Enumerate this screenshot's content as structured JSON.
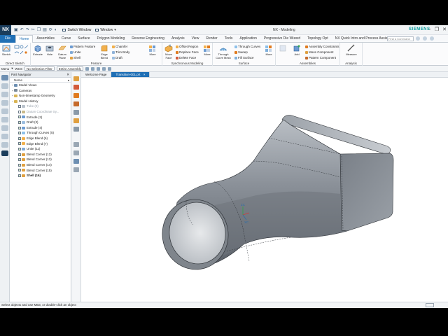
{
  "titlebar": {
    "logo": "NX",
    "switch_window": "Switch Window",
    "window_menu": "Window",
    "app_title": "NX - Modeling",
    "brand": "SIEMENS"
  },
  "tabs": {
    "file": "File",
    "items": [
      "Home",
      "Assemblies",
      "Curve",
      "Surface",
      "Polygon Modeling",
      "Reverse Engineering",
      "Analysis",
      "View",
      "Render",
      "Tools",
      "Application",
      "Progressive Die Wizard",
      "Topology Opt",
      "NX Quick Intro and Process Assistant"
    ],
    "active": "Home",
    "command_search_placeholder": "Find a Command"
  },
  "ribbon": {
    "direct_sketch": {
      "label": "Direct Sketch",
      "sketch": "Sketch"
    },
    "feature": {
      "label": "Feature",
      "extrude": "Extrude",
      "hole": "Hole",
      "datum_plane": "Datum Plane",
      "pattern_feature": "Pattern Feature",
      "unite": "Unite",
      "shell": "Shell",
      "edge_blend": "Edge Blend",
      "chamfer": "Chamfer",
      "trim_body": "Trim Body",
      "draft": "Draft",
      "more": "More"
    },
    "synchronous": {
      "label": "Synchronous Modeling",
      "move_face": "Move Face",
      "offset_region": "Offset Region",
      "replace_face": "Replace Face",
      "delete_face": "Delete Face",
      "more": "More"
    },
    "surface": {
      "label": "Surface",
      "through_curve_mesh": "Through Curve Mesh",
      "through_curves": "Through Curves",
      "sweep": "Sweep",
      "fill_surface": "Fill Surface",
      "more": "More"
    },
    "assemblies": {
      "label": "Assemblies",
      "add": "Add",
      "assembly_constraints": "Assembly Constraints",
      "move_component": "Move Component",
      "pattern_component": "Pattern Component"
    },
    "analysis": {
      "label": "Analysis",
      "measure": "Measure"
    }
  },
  "selection_bar": {
    "menu": "Menu",
    "wcs": "WCS",
    "filter": "No Selection Filter",
    "scope": "Entire Assembly"
  },
  "navigator": {
    "title": "Part Navigator",
    "col_name": "Name",
    "nodes": [
      {
        "label": "Model Views",
        "level": 1,
        "icon": "views",
        "exp": "+"
      },
      {
        "label": "Cameras",
        "level": 1,
        "icon": "camera",
        "exp": "+"
      },
      {
        "label": "Non-timestamp Geometry",
        "level": 1,
        "icon": "folder",
        "exp": "+"
      },
      {
        "label": "Model History",
        "level": 1,
        "icon": "folder",
        "exp": "−"
      },
      {
        "label": "Tube (0)",
        "level": 2,
        "icon": "tube",
        "state": "grey"
      },
      {
        "label": "Datum Coordinate Sy...",
        "level": 2,
        "icon": "datum",
        "state": "grey"
      },
      {
        "label": "Extrude (2)",
        "level": 2,
        "icon": "extrude"
      },
      {
        "label": "Draft (3)",
        "level": 2,
        "icon": "draft"
      },
      {
        "label": "Extrude (4)",
        "level": 2,
        "icon": "extrude"
      },
      {
        "label": "Through Curves (5)",
        "level": 2,
        "icon": "curves"
      },
      {
        "label": "Edge Blend (6)",
        "level": 2,
        "icon": "blend"
      },
      {
        "label": "Edge Blend (7)",
        "level": 2,
        "icon": "blend"
      },
      {
        "label": "Unite (11)",
        "level": 2,
        "icon": "unite"
      },
      {
        "label": "Blend Corner (12)",
        "level": 2,
        "icon": "corner"
      },
      {
        "label": "Blend Corner (13)",
        "level": 2,
        "icon": "corner"
      },
      {
        "label": "Blend Corner (14)",
        "level": 2,
        "icon": "corner"
      },
      {
        "label": "Blend Corner (15)",
        "level": 2,
        "icon": "corner"
      },
      {
        "label": "Shell (16)",
        "level": 2,
        "icon": "shell",
        "state": "bold"
      }
    ]
  },
  "graphics": {
    "tabs": [
      "Welcome Page",
      "Transition-001.prt"
    ],
    "active_tab": 1,
    "modified_mark": "×"
  },
  "status": {
    "prompt": "Select objects and use MB3, or double-click an object"
  },
  "colors": {
    "accent": "#1f6fb5",
    "brand": "#009999",
    "body_shade": "#8a9098"
  }
}
